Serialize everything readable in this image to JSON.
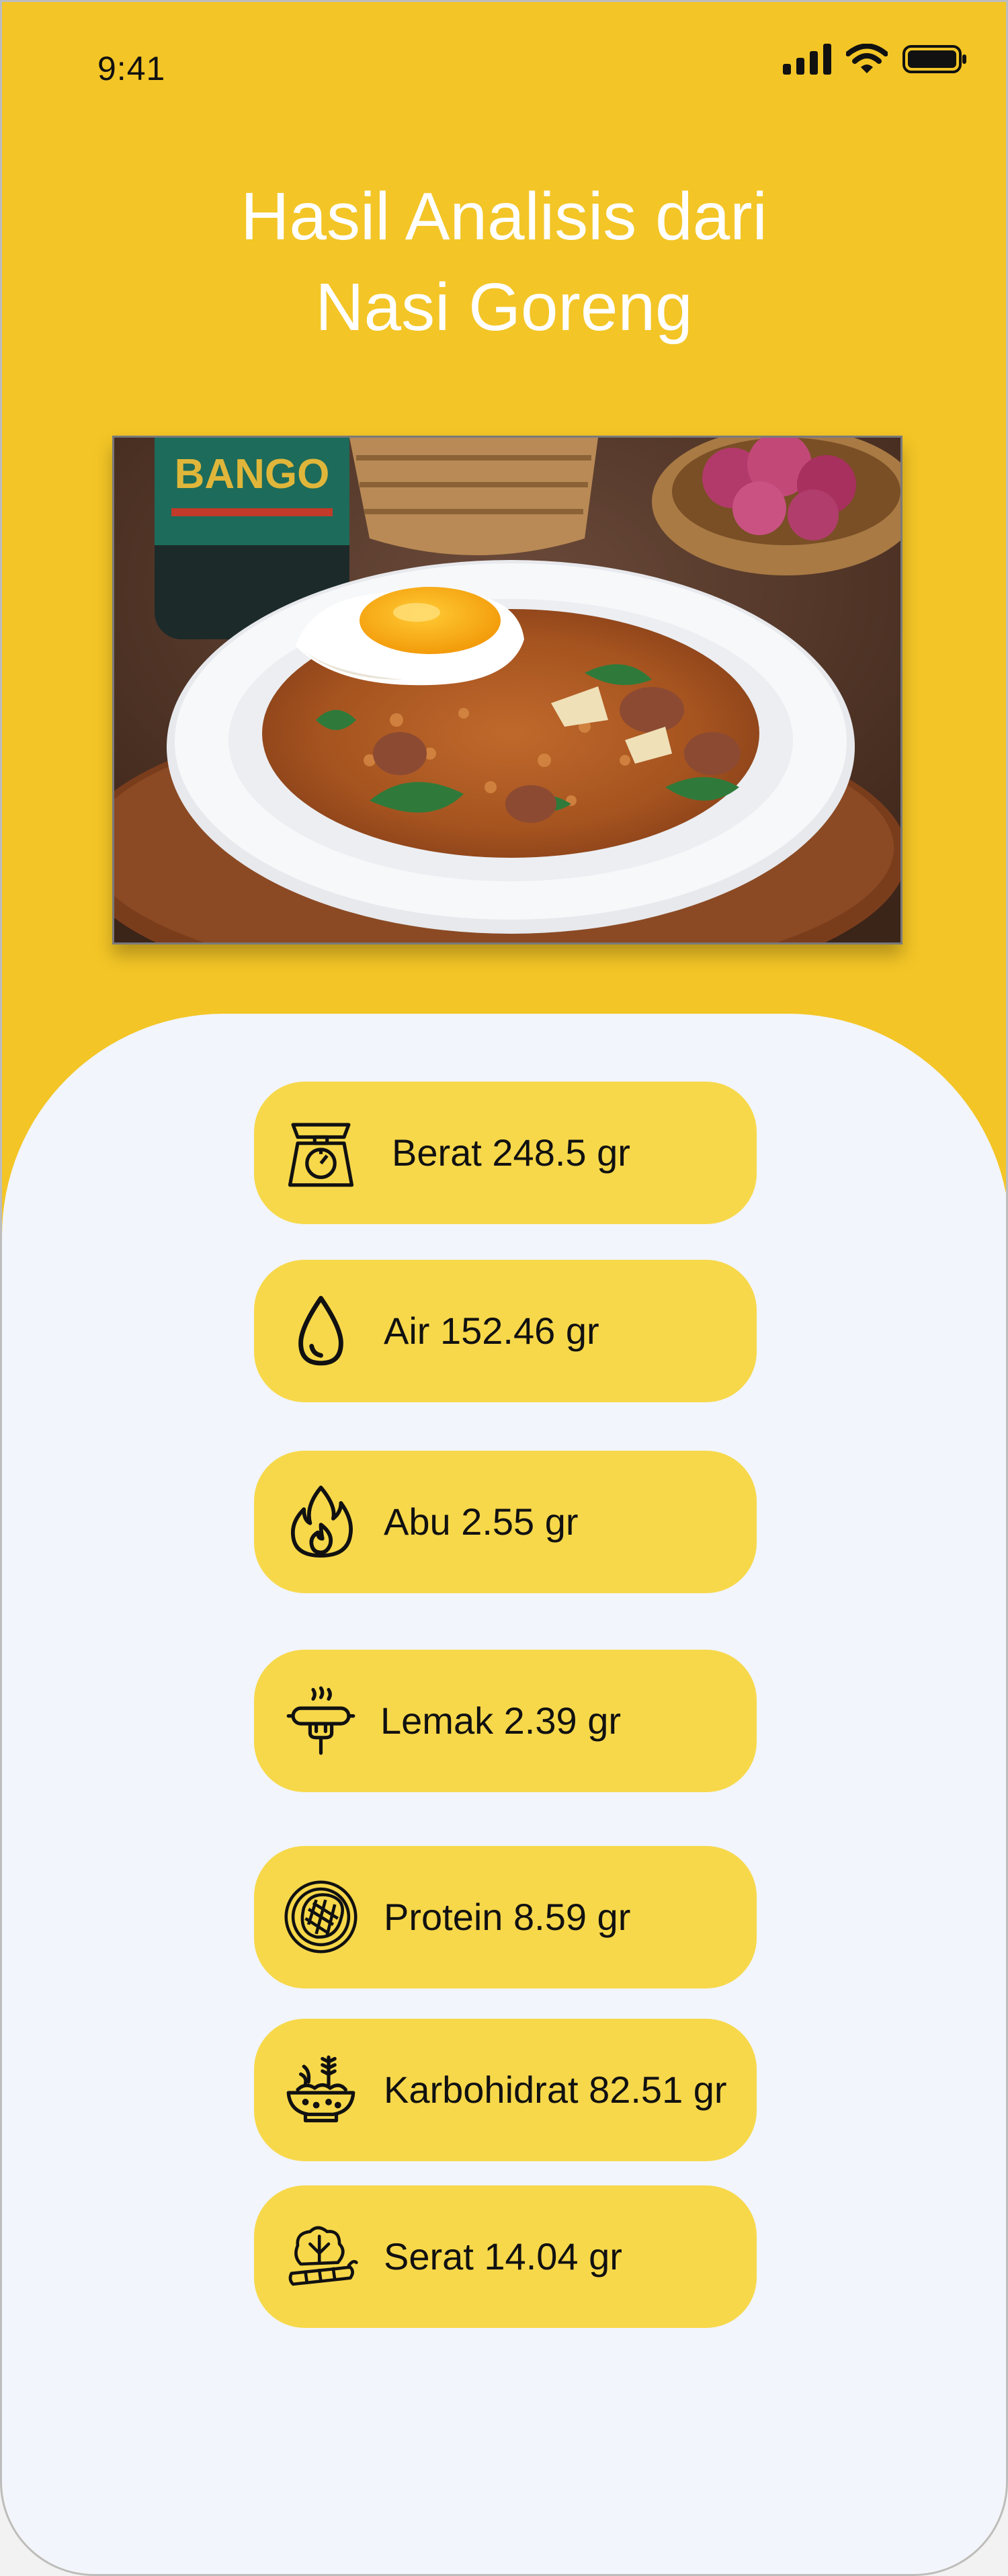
{
  "status_bar": {
    "time": "9:41"
  },
  "header": {
    "title_line1": "Hasil Analisis dari",
    "title_line2": "Nasi Goreng"
  },
  "photo": {
    "label": "BANGO"
  },
  "nutrients": [
    {
      "icon": "scale-icon",
      "label": "Berat 248.5 gr"
    },
    {
      "icon": "water-drop-icon",
      "label": "Air 152.46 gr"
    },
    {
      "icon": "fire-icon",
      "label": "Abu 2.55 gr"
    },
    {
      "icon": "sausage-fork-icon",
      "label": "Lemak 2.39 gr"
    },
    {
      "icon": "steak-plate-icon",
      "label": "Protein 8.59 gr"
    },
    {
      "icon": "grain-bowl-icon",
      "label": "Karbohidrat 82.51 gr"
    },
    {
      "icon": "vegetables-icon",
      "label": "Serat 14.04 gr"
    }
  ],
  "colors": {
    "background": "#F3C526",
    "card": "#F7D84A",
    "sheet": "#F2F5FC",
    "title": "#FFFFFF"
  }
}
